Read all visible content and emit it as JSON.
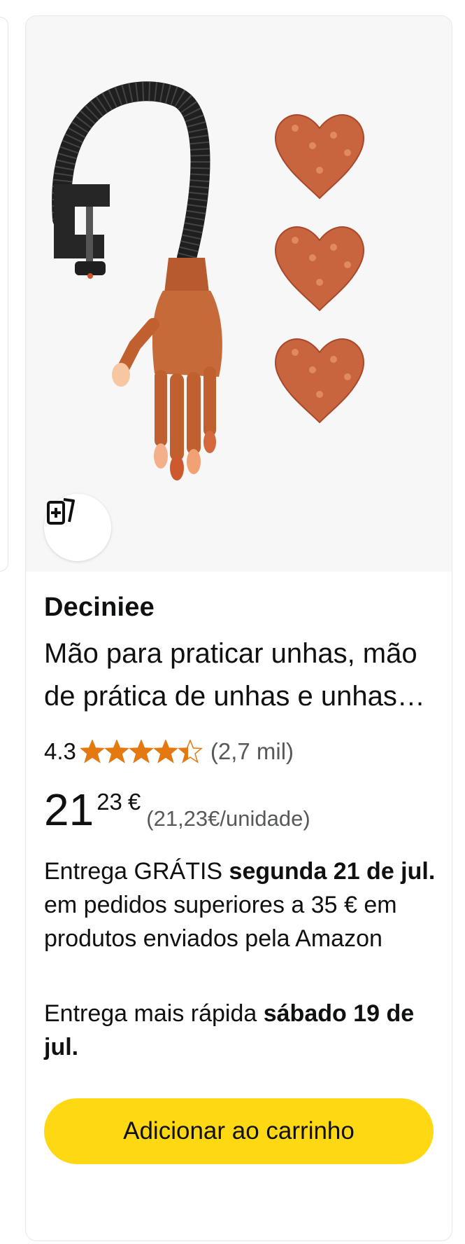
{
  "product": {
    "brand": "Deciniee",
    "title": "Mão para praticar unhas, mão de prática de unhas e unhas falsas para manicure",
    "rating_value": "4.3",
    "rating_stars": 4.3,
    "rating_count": "(2,7 mil)",
    "price_whole": "21",
    "price_fraction": "23",
    "price_currency": "€",
    "unit_price": "(21,23€/unidade)"
  },
  "delivery": {
    "prefix": "Entrega GRÁTIS ",
    "date_bold": "segunda 21 de jul.",
    "suffix": " em pedidos superiores a 35 € em produtos enviados pela Amazon"
  },
  "fast_delivery": {
    "prefix": "Entrega mais rápida ",
    "date_bold": "sábado 19 de jul."
  },
  "actions": {
    "add_to_cart": "Adicionar ao carrinho",
    "compare_icon": "add-to-compare-icon"
  },
  "colors": {
    "star": "#e47911",
    "button": "#ffd814",
    "image_bg": "#f7f7f7",
    "nail": "#c9653e"
  }
}
